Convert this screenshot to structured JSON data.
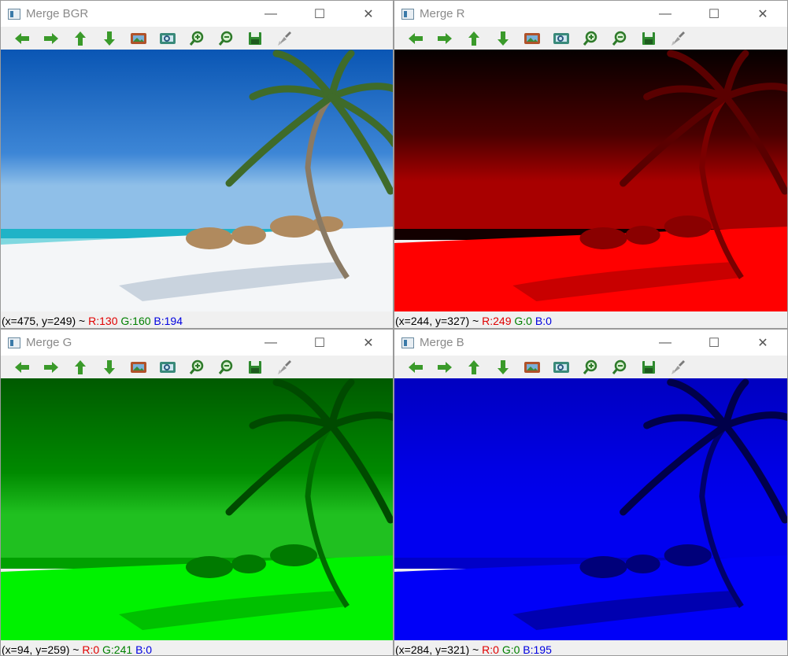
{
  "windows": [
    {
      "id": "bgr",
      "title": "Merge BGR",
      "status": {
        "coords": "(x=475, y=249) ~ ",
        "r": "R:130",
        "g": "G:160",
        "b": "B:194"
      }
    },
    {
      "id": "r",
      "title": "Merge R",
      "status": {
        "coords": "(x=244, y=327) ~ ",
        "r": "R:249",
        "g": "G:0",
        "b": "B:0"
      }
    },
    {
      "id": "g",
      "title": "Merge G",
      "status": {
        "coords": "(x=94, y=259) ~ ",
        "r": "R:0",
        "g": "G:241",
        "b": "B:0"
      }
    },
    {
      "id": "b",
      "title": "Merge B",
      "status": {
        "coords": "(x=284, y=321) ~ ",
        "r": "R:0",
        "g": "G:0",
        "b": "B:195"
      }
    }
  ],
  "caption_buttons": {
    "minimize": "—",
    "maximize": "☐",
    "close": "✕"
  },
  "toolbar_icons": [
    "pan-left-icon",
    "pan-right-icon",
    "pan-up-icon",
    "pan-down-icon",
    "zoom-original-icon",
    "zoom-fit-icon",
    "zoom-in-icon",
    "zoom-out-icon",
    "save-icon",
    "properties-icon"
  ],
  "colors": {
    "arrow_green": "#3a9a2a",
    "tint_r": "#ff0000",
    "tint_g": "#00ff00",
    "tint_b": "#0000ff"
  }
}
